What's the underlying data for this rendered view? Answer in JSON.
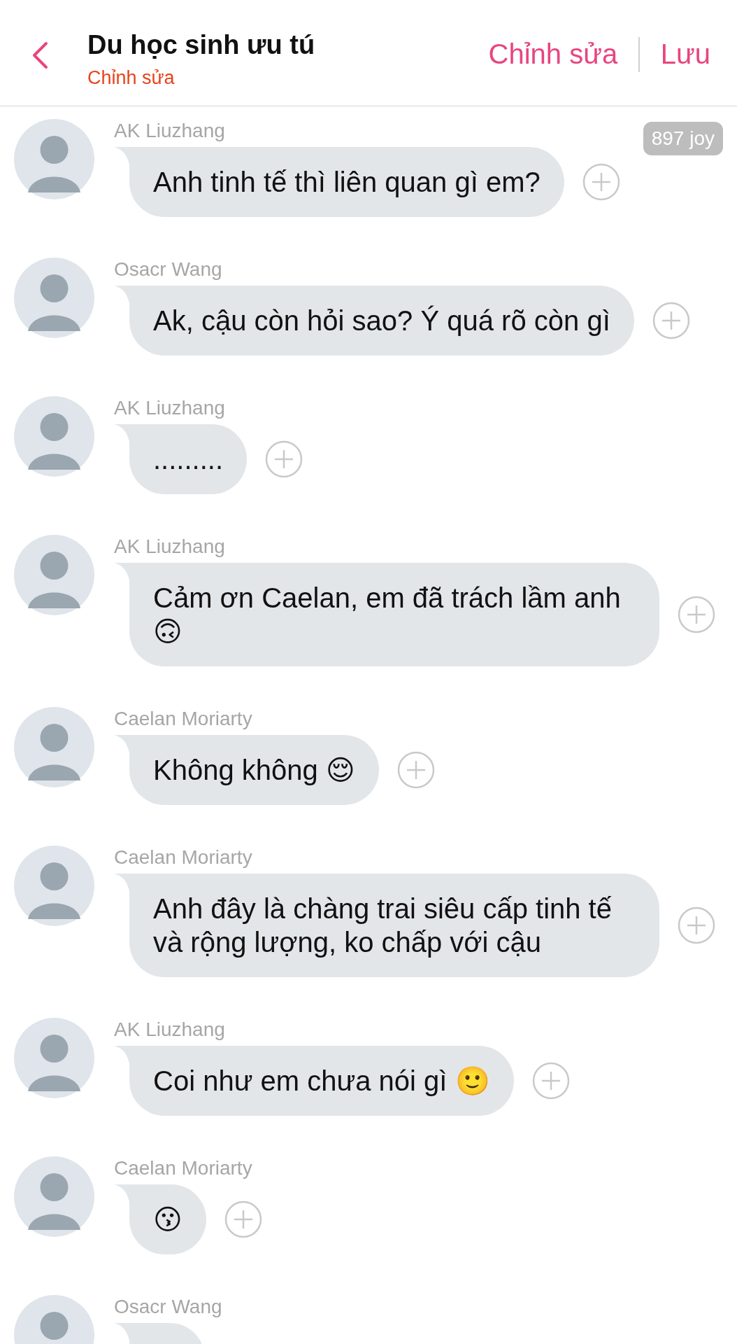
{
  "header": {
    "title": "Du học sinh ưu tú",
    "subtitle": "Chỉnh sửa",
    "actions": [
      "Chỉnh sửa",
      "Lưu"
    ]
  },
  "badge": "897 joy",
  "messages": [
    {
      "sender": "AK Liuzhang",
      "text": "Anh tinh tế thì liên quan gì em?"
    },
    {
      "sender": "Osacr Wang",
      "text": "Ak, cậu còn hỏi sao? Ý quá rõ còn gì"
    },
    {
      "sender": "AK Liuzhang",
      "text": "........."
    },
    {
      "sender": "AK Liuzhang",
      "text": "Cảm ơn Caelan, em đã trách lầm anh 🙃"
    },
    {
      "sender": "Caelan Moriarty",
      "text": "Không không 😌"
    },
    {
      "sender": "Caelan Moriarty",
      "text": "Anh đây là chàng trai siêu cấp tinh tế và rộng lượng, ko chấp với cậu"
    },
    {
      "sender": "AK Liuzhang",
      "text": "Coi như em chưa nói gì 🙂"
    },
    {
      "sender": "Caelan Moriarty",
      "text": "😗"
    },
    {
      "sender": "Osacr Wang"
    }
  ]
}
